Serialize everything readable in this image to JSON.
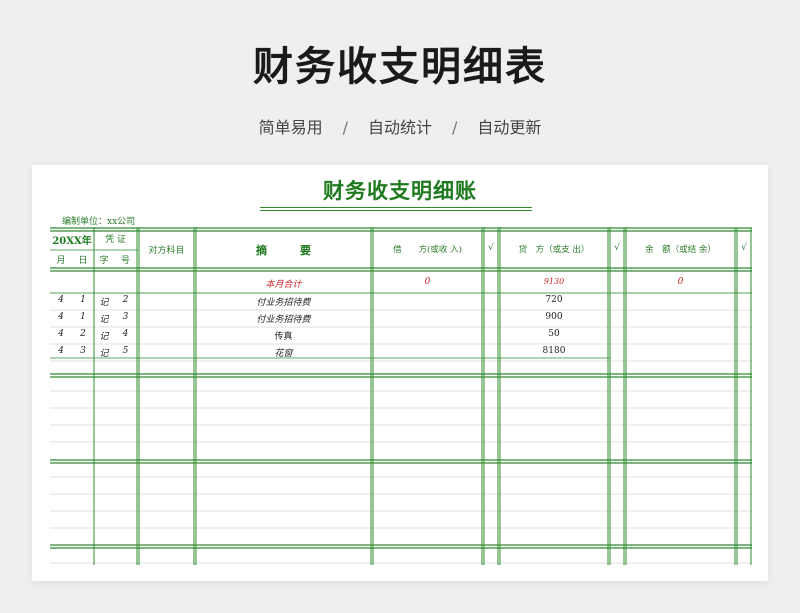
{
  "hero": {
    "title": "财务收支明细表",
    "features": [
      "简单易用",
      "自动统计",
      "自动更新"
    ],
    "separator": "/"
  },
  "sheet": {
    "title": "财务收支明细账",
    "unit_label": "编制单位：xx公司",
    "headers": {
      "year": "20XX年",
      "voucher": "凭 证",
      "month": "月",
      "day": "日",
      "zi": "字",
      "hao": "号",
      "counterpart": "对方科目",
      "summary": "摘　　　要",
      "debit": "借　　方(或收 入)",
      "credit": "贷　方（或支 出）",
      "balance": "余　额（或结 余）",
      "check": "√"
    },
    "total_row": {
      "summary": "本月合计",
      "debit": "0",
      "credit": "9130",
      "balance": "0"
    },
    "rows": [
      {
        "month": "4",
        "day": "1",
        "zi": "记",
        "hao": "2",
        "summary": "付业务招待费",
        "credit": "720"
      },
      {
        "month": "4",
        "day": "1",
        "zi": "记",
        "hao": "3",
        "summary": "付业务招待费",
        "credit": "900"
      },
      {
        "month": "4",
        "day": "2",
        "zi": "记",
        "hao": "4",
        "summary": "传真",
        "credit": "50"
      },
      {
        "month": "4",
        "day": "3",
        "zi": "记",
        "hao": "5",
        "summary": "花窗",
        "credit": "8180"
      }
    ]
  },
  "colors": {
    "accent_green": "#1f7a1f",
    "grid_green": "#2e8b2e",
    "red": "#d2262c"
  }
}
